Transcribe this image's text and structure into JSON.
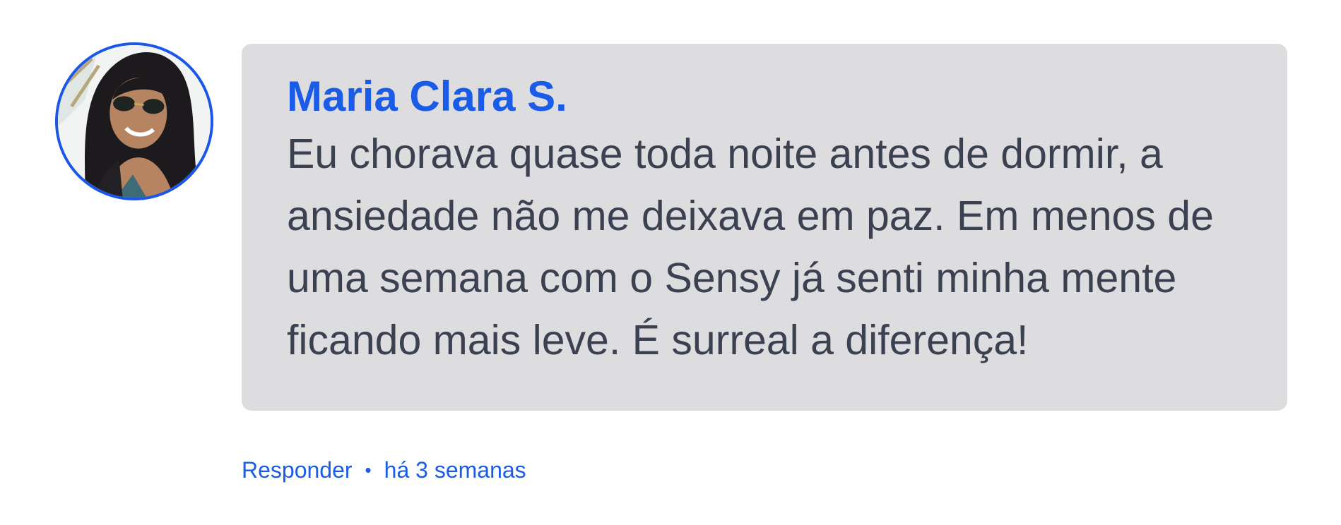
{
  "comment": {
    "author": "Maria Clara S.",
    "text": "Eu chorava quase toda noite antes de dormir, a ansiedade não me deixava em paz. Em menos de uma semana com o Sensy já senti minha mente ficando mais leve. É surreal a diferença!",
    "reply_label": "Responder",
    "separator": "•",
    "timestamp": "há 3 semanas"
  },
  "colors": {
    "accent": "#1a5ce8",
    "bubble_bg": "#dddde0",
    "body_text": "#3b4150"
  }
}
